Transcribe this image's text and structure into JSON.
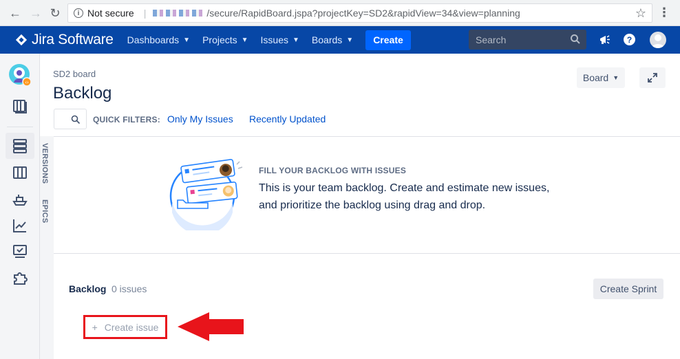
{
  "browser": {
    "security": "Not secure",
    "url_path": "/secure/RapidBoard.jspa?projectKey=SD2&rapidView=34&view=planning"
  },
  "topnav": {
    "product": "Jira Software",
    "menu": [
      {
        "label": "Dashboards"
      },
      {
        "label": "Projects"
      },
      {
        "label": "Issues"
      },
      {
        "label": "Boards"
      }
    ],
    "create_label": "Create",
    "search_placeholder": "Search"
  },
  "sidebar": {
    "icons": [
      "project-avatar",
      "board-icon",
      "backlog-icon",
      "active-sprints-icon",
      "releases-icon",
      "reports-icon",
      "issues-icon",
      "add-ons-icon"
    ]
  },
  "vtabs": {
    "versions": "VERSIONS",
    "epics": "EPICS"
  },
  "header": {
    "breadcrumb": "SD2 board",
    "title": "Backlog",
    "board_button": "Board"
  },
  "quick_filters": {
    "label": "QUICK FILTERS:",
    "items": [
      {
        "label": "Only My Issues"
      },
      {
        "label": "Recently Updated"
      }
    ]
  },
  "empty_state": {
    "heading": "FILL YOUR BACKLOG WITH ISSUES",
    "line1": "This is your team backlog. Create and estimate new issues,",
    "line2": "and prioritize the backlog using drag and drop."
  },
  "backlog": {
    "title": "Backlog",
    "count": "0 issues",
    "create_sprint": "Create Sprint",
    "create_issue": "Create issue"
  },
  "colors": {
    "nav_bg": "#0747a6",
    "create_btn": "#0065ff",
    "link": "#0052cc",
    "annotation_red": "#e8141b"
  }
}
